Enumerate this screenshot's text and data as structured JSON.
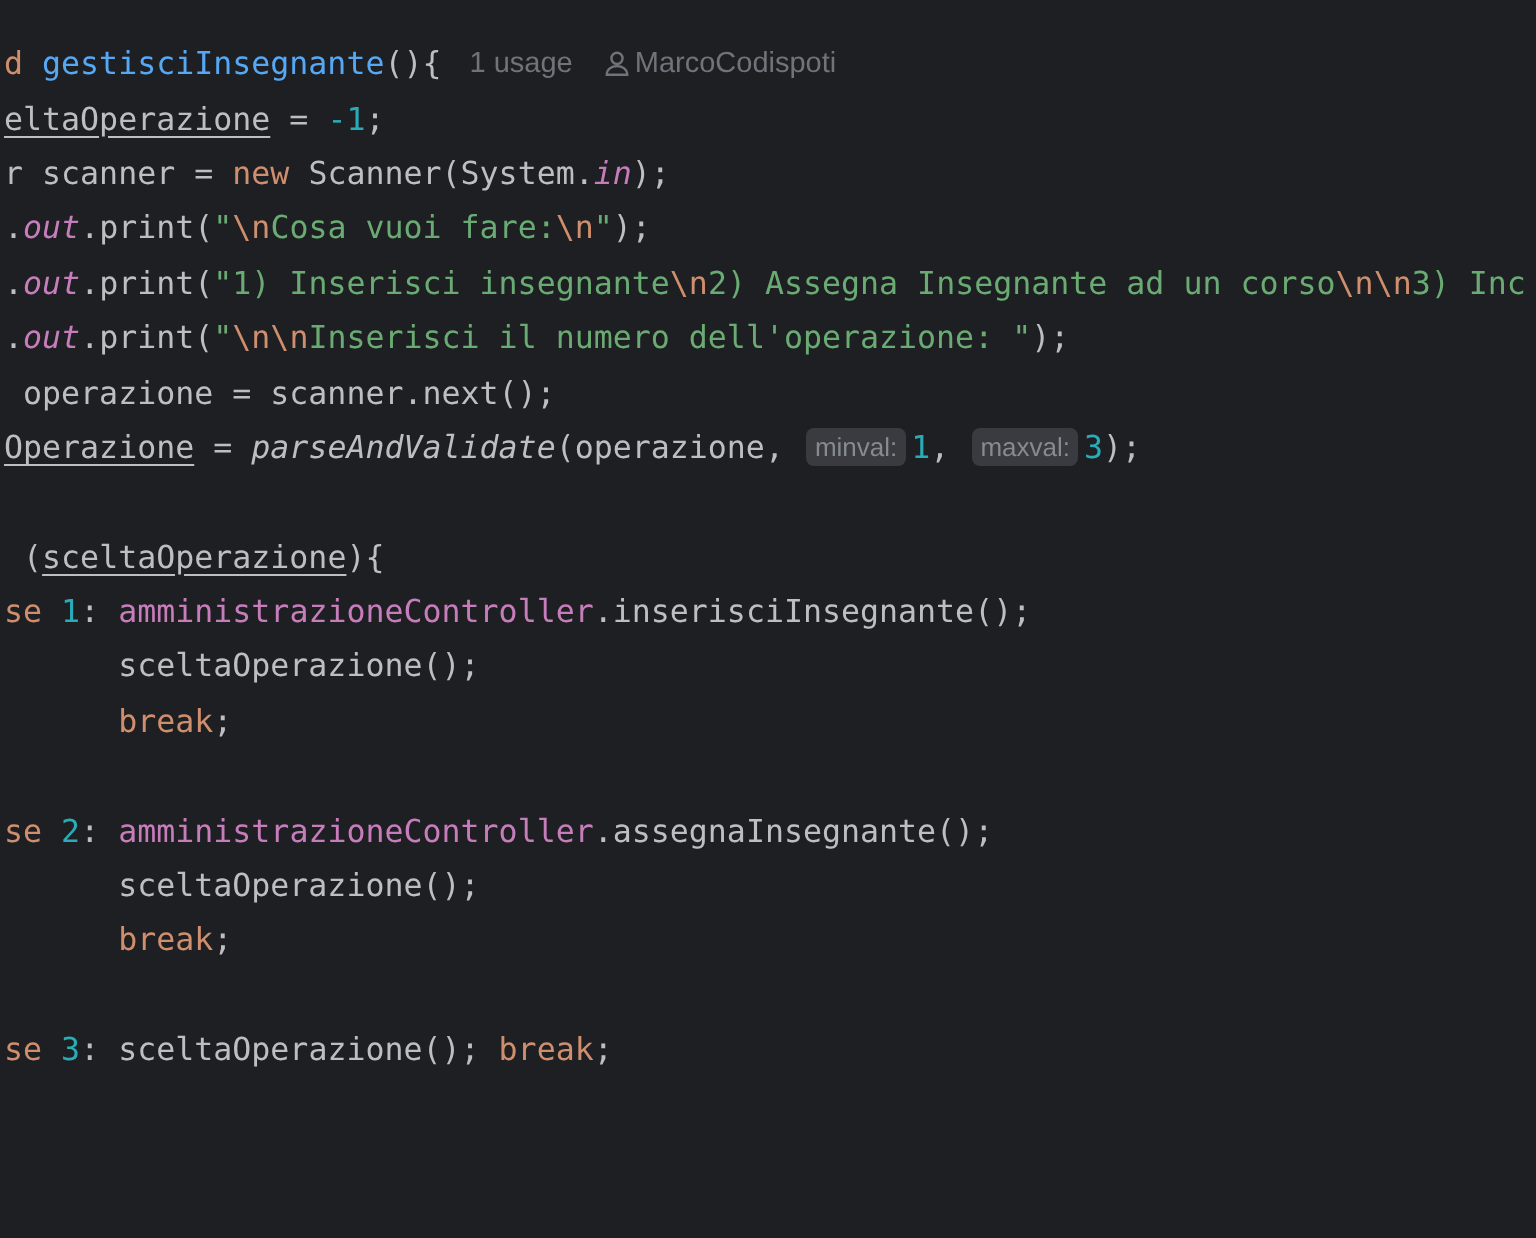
{
  "editor": {
    "lines": [
      {
        "kind": "code",
        "tokens": [
          {
            "text": "d",
            "kind": "keyword"
          },
          {
            "text": " gestisciInsegnante",
            "kind": "decl"
          },
          {
            "text": "(){",
            "kind": "plain"
          },
          {
            "text": "1 usage",
            "kind": "usage"
          },
          {
            "text": "MarcoCodispoti",
            "kind": "author"
          }
        ]
      },
      {
        "kind": "code",
        "tokens": [
          {
            "text": "eltaOperazione",
            "kind": "var"
          },
          {
            "text": " = ",
            "kind": "plain"
          },
          {
            "text": "-1",
            "kind": "number"
          },
          {
            "text": ";",
            "kind": "plain"
          }
        ]
      },
      {
        "kind": "code",
        "tokens": [
          {
            "text": "r scanner = ",
            "kind": "plain"
          },
          {
            "text": "new",
            "kind": "keyword"
          },
          {
            "text": " Scanner(System.",
            "kind": "plain"
          },
          {
            "text": "in",
            "kind": "static"
          },
          {
            "text": ");",
            "kind": "plain"
          }
        ]
      },
      {
        "kind": "code",
        "tokens": [
          {
            "text": ".",
            "kind": "plain"
          },
          {
            "text": "out",
            "kind": "static"
          },
          {
            "text": ".print(",
            "kind": "plain"
          },
          {
            "text": "\"",
            "kind": "string"
          },
          {
            "text": "\\n",
            "kind": "escape"
          },
          {
            "text": "Cosa vuoi fare:",
            "kind": "string"
          },
          {
            "text": "\\n",
            "kind": "escape"
          },
          {
            "text": "\"",
            "kind": "string"
          },
          {
            "text": ");",
            "kind": "plain"
          }
        ]
      },
      {
        "kind": "code",
        "tokens": [
          {
            "text": ".",
            "kind": "plain"
          },
          {
            "text": "out",
            "kind": "static"
          },
          {
            "text": ".print(",
            "kind": "plain"
          },
          {
            "text": "\"1) Inserisci insegnante",
            "kind": "string"
          },
          {
            "text": "\\n",
            "kind": "escape"
          },
          {
            "text": "2) Assegna Insegnante ad un corso",
            "kind": "string"
          },
          {
            "text": "\\n\\n",
            "kind": "escape"
          },
          {
            "text": "3) Inc",
            "kind": "string"
          }
        ]
      },
      {
        "kind": "code",
        "tokens": [
          {
            "text": ".",
            "kind": "plain"
          },
          {
            "text": "out",
            "kind": "static"
          },
          {
            "text": ".print(",
            "kind": "plain"
          },
          {
            "text": "\"",
            "kind": "string"
          },
          {
            "text": "\\n\\n",
            "kind": "escape"
          },
          {
            "text": "Inserisci il numero dell'operazione: \"",
            "kind": "string"
          },
          {
            "text": ");",
            "kind": "plain"
          }
        ]
      },
      {
        "kind": "code",
        "tokens": [
          {
            "text": " operazione = scanner.next();",
            "kind": "plain"
          }
        ]
      },
      {
        "kind": "code",
        "tokens": [
          {
            "text": "Operazione",
            "kind": "var"
          },
          {
            "text": " = ",
            "kind": "plain"
          },
          {
            "text": "parseAndValidate",
            "kind": "call"
          },
          {
            "text": "(operazione, ",
            "kind": "plain"
          },
          {
            "text": "minval:",
            "kind": "hint"
          },
          {
            "text": "1",
            "kind": "number"
          },
          {
            "text": ", ",
            "kind": "plain"
          },
          {
            "text": "maxval:",
            "kind": "hint"
          },
          {
            "text": "3",
            "kind": "number"
          },
          {
            "text": ");",
            "kind": "plain"
          }
        ]
      },
      {
        "kind": "blank"
      },
      {
        "kind": "code",
        "tokens": [
          {
            "text": " (",
            "kind": "plain"
          },
          {
            "text": "sceltaOperazione",
            "kind": "var"
          },
          {
            "text": "){",
            "kind": "plain"
          }
        ]
      },
      {
        "kind": "code",
        "tokens": [
          {
            "text": "se",
            "kind": "keyword"
          },
          {
            "text": " 1",
            "kind": "number"
          },
          {
            "text": ": ",
            "kind": "plain"
          },
          {
            "text": "amministrazioneController",
            "kind": "member"
          },
          {
            "text": ".inserisciInsegnante();",
            "kind": "plain"
          }
        ]
      },
      {
        "kind": "code",
        "tokens": [
          {
            "text": "      sceltaOperazione();",
            "kind": "plain"
          }
        ]
      },
      {
        "kind": "code",
        "tokens": [
          {
            "text": "      break",
            "kind": "keyword"
          },
          {
            "text": ";",
            "kind": "plain"
          }
        ]
      },
      {
        "kind": "blank"
      },
      {
        "kind": "code",
        "tokens": [
          {
            "text": "se",
            "kind": "keyword"
          },
          {
            "text": " 2",
            "kind": "number"
          },
          {
            "text": ": ",
            "kind": "plain"
          },
          {
            "text": "amministrazioneController",
            "kind": "member"
          },
          {
            "text": ".assegnaInsegnante();",
            "kind": "plain"
          }
        ]
      },
      {
        "kind": "code",
        "tokens": [
          {
            "text": "      sceltaOperazione();",
            "kind": "plain"
          }
        ]
      },
      {
        "kind": "code",
        "tokens": [
          {
            "text": "      break",
            "kind": "keyword"
          },
          {
            "text": ";",
            "kind": "plain"
          }
        ]
      },
      {
        "kind": "blank"
      },
      {
        "kind": "code",
        "tokens": [
          {
            "text": "se",
            "kind": "keyword"
          },
          {
            "text": " 3",
            "kind": "number"
          },
          {
            "text": ": sceltaOperazione(); ",
            "kind": "plain"
          },
          {
            "text": "break",
            "kind": "keyword"
          },
          {
            "text": ";",
            "kind": "plain"
          }
        ]
      }
    ]
  }
}
